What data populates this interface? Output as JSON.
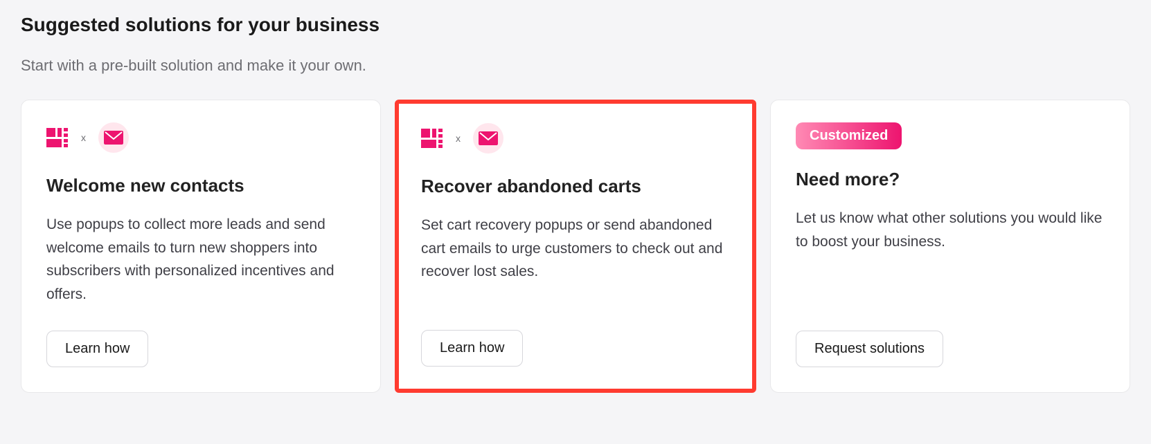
{
  "section": {
    "title": "Suggested solutions for your business",
    "subtitle": "Start with a pre-built solution and make it your own."
  },
  "cards": [
    {
      "title": "Welcome new contacts",
      "description": "Use popups to collect more leads and send welcome emails to turn new shoppers into subscribers with personalized incentives and offers.",
      "button_label": "Learn how",
      "icon_separator": "x"
    },
    {
      "title": "Recover abandoned carts",
      "description": "Set cart recovery popups or send abandoned cart emails to urge customers to check out and recover lost sales.",
      "button_label": "Learn how",
      "icon_separator": "x",
      "highlighted": true
    },
    {
      "title": "Need more?",
      "description": "Let us know what other solutions you would like to boost your business.",
      "button_label": "Request solutions",
      "badge": "Customized"
    }
  ],
  "colors": {
    "brand_pink": "#ed146f",
    "highlight_red": "#ff3b30",
    "badge_gradient_start": "#ff8ab4",
    "badge_gradient_end": "#ed146f"
  }
}
